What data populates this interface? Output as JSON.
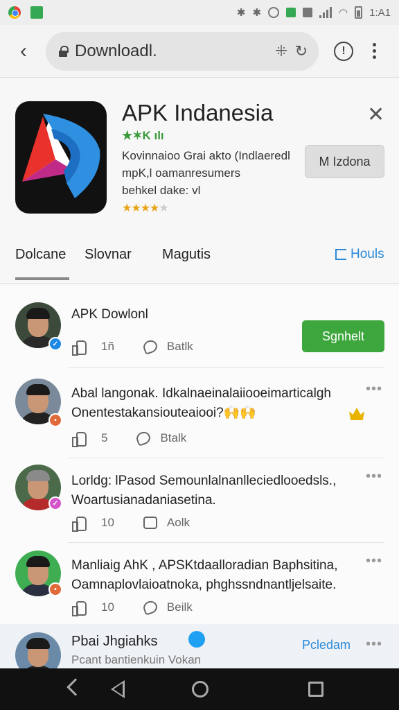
{
  "status_bar": {
    "time": "1:A1",
    "icons": [
      "chrome-icon",
      "download-icon",
      "bluetooth-icon",
      "vibrate-icon",
      "alarm-icon",
      "signal-icon",
      "wifi-icon",
      "battery-icon"
    ]
  },
  "browser": {
    "url": "Downloadl.",
    "url_icon_1": "ꔰ",
    "reload_glyph": "↻",
    "info_glyph": "!"
  },
  "app": {
    "name": "APK Indanesia",
    "subtitle": "★✶K ılı",
    "description_lines": [
      "Kovinnaioo Grai akto (Indlaeredl",
      "mpK,l oamanresumers",
      "behkel dake: vl"
    ],
    "install_label": "M Izdona",
    "rating_stars": 4,
    "colors": {
      "accent_green": "#3da73d",
      "link_blue": "#2a8ad8"
    }
  },
  "tabs": {
    "items": [
      "Dolcane",
      "Slovnar",
      "Magutis"
    ],
    "right": "Houls"
  },
  "feed": {
    "posts": [
      {
        "title": "APK Dowlonl",
        "likes": "1ñ",
        "comment": "Batlk",
        "follow_label": "Sgnhelt"
      },
      {
        "title": "Abal langonak. Idkalnaeinalaiiooeimarticalgh Onentestakansiouteaiooi?🙌🙌",
        "likes": "5",
        "comment": "Btalk"
      },
      {
        "title": "Lorldg: lPasod Semounlalnanlleciedlooedsls., Woartusianadaniasetina.",
        "likes": "10",
        "comment": "Aolk"
      },
      {
        "title": "Manliaig AhK , APSKtdaalloradian Baphsitina, Oamnaplovlaioatnoka, phghssndnantljelsaite.",
        "likes": "10",
        "comment": "Beilk"
      }
    ],
    "last_post": {
      "title": "Pbai Jhgiahks",
      "subtitle": "Pcant bantienkuin Vokan",
      "link": "Pcledam"
    }
  },
  "nav": {
    "items": [
      "back",
      "triangle-back",
      "home",
      "recents"
    ]
  }
}
